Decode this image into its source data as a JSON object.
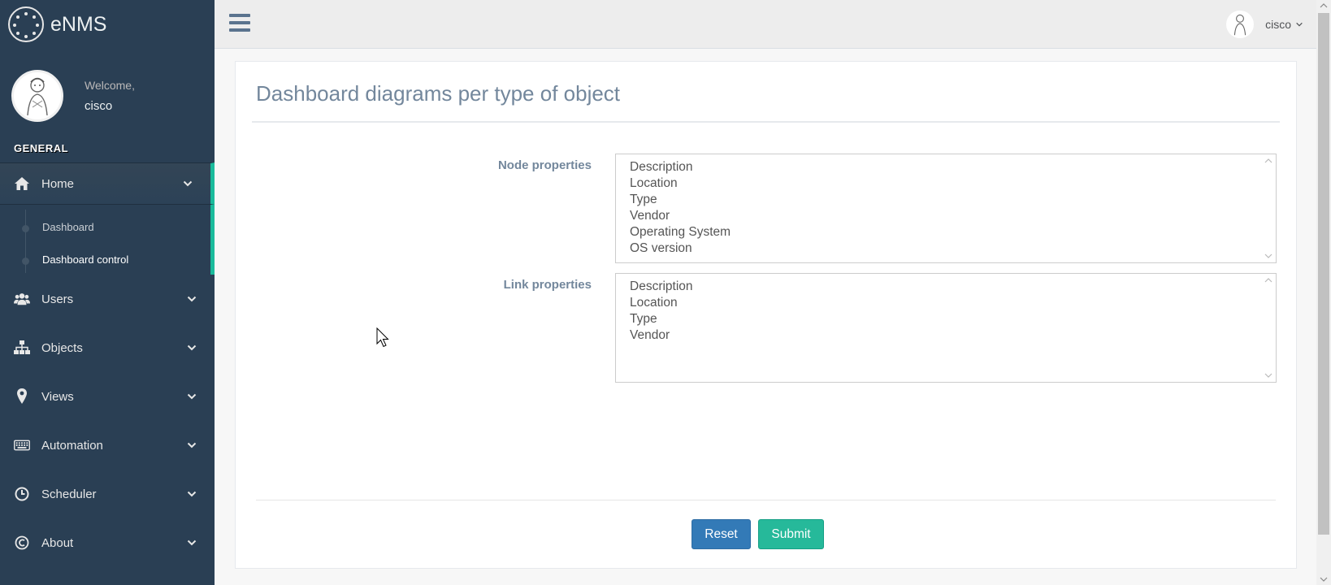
{
  "app": {
    "brand": "eNMS"
  },
  "profile": {
    "welcome": "Welcome,",
    "name": "cisco"
  },
  "sidebar": {
    "section_title": "GENERAL",
    "items": [
      {
        "label": "Home",
        "icon": "home-icon"
      },
      {
        "label": "Users",
        "icon": "users-icon"
      },
      {
        "label": "Objects",
        "icon": "sitemap-icon"
      },
      {
        "label": "Views",
        "icon": "map-marker-icon"
      },
      {
        "label": "Automation",
        "icon": "keyboard-icon"
      },
      {
        "label": "Scheduler",
        "icon": "clock-icon"
      },
      {
        "label": "About",
        "icon": "copyright-icon"
      }
    ],
    "home_submenu": [
      {
        "label": "Dashboard"
      },
      {
        "label": "Dashboard control"
      }
    ]
  },
  "topnav": {
    "user_name": "cisco"
  },
  "page": {
    "title": "Dashboard diagrams per type of object",
    "node_label": "Node properties",
    "node_options": [
      "Description",
      "Location",
      "Type",
      "Vendor",
      "Operating System",
      "OS version"
    ],
    "link_label": "Link properties",
    "link_options": [
      "Description",
      "Location",
      "Type",
      "Vendor"
    ],
    "reset_label": "Reset",
    "submit_label": "Submit"
  },
  "colors": {
    "sidebar_bg": "#2a3f54",
    "accent": "#1abb9c",
    "reset_btn": "#337ab7",
    "submit_btn": "#26b99a"
  }
}
